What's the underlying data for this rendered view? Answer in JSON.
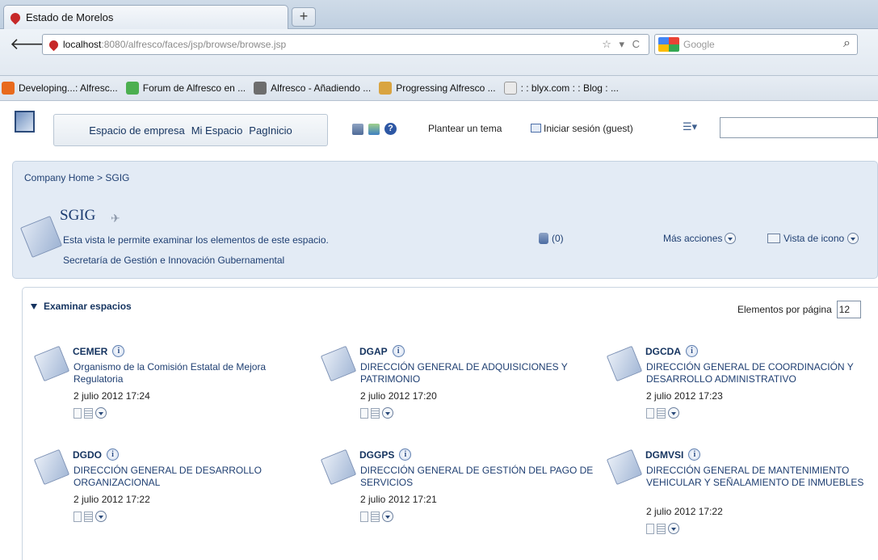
{
  "browser": {
    "tab_title": "Estado de Morelos",
    "new_tab": "+",
    "url_host": "localhost",
    "url_path": ":8080/alfresco/faces/jsp/browse/browse.jsp",
    "search_placeholder": "Google",
    "bookmarks": [
      {
        "label": "Developing...: Alfresc...",
        "color": "#e86a1c"
      },
      {
        "label": "Forum de Alfresco en ...",
        "color": "#4caf50"
      },
      {
        "label": "Alfresco - Añadiendo ...",
        "color": "#6d6d6d"
      },
      {
        "label": "Progressing Alfresco ...",
        "color": "#d9a441"
      },
      {
        "label": ": : blyx.com : : Blog : ...",
        "color": "#eaeaea"
      }
    ]
  },
  "toolbar": {
    "nav_company": "Espacio de empresa",
    "nav_my": "Mi Espacio",
    "nav_home": "PagInicio",
    "ask_topic": "Plantear un tema",
    "login": "Iniciar sesión (guest)"
  },
  "space": {
    "breadcrumb": "Company Home > SGIG",
    "title": "SGIG",
    "description": "Esta vista le permite examinar los elementos de este espacio.",
    "subdescription": "Secretaría de Gestión e Innovación Gubernamental",
    "pending_count": "(0)",
    "more_actions": "Más acciones",
    "icon_view": "Vista de icono"
  },
  "browse": {
    "title": "Examinar espacios",
    "per_page_label": "Elementos por página",
    "per_page_value": "12",
    "spaces": [
      {
        "name": "CEMER",
        "desc": "Organismo de la Comisión Estatal de Mejora Regulatoria",
        "date": "2 julio 2012 17:24"
      },
      {
        "name": "DGAP",
        "desc": "DIRECCIÓN GENERAL DE ADQUISICIONES Y PATRIMONIO",
        "date": "2 julio 2012 17:20"
      },
      {
        "name": "DGCDA",
        "desc": "DIRECCIÓN GENERAL DE COORDINACIÓN Y DESARROLLO ADMINISTRATIVO",
        "date": "2 julio 2012 17:23"
      },
      {
        "name": "DGDO",
        "desc": "DIRECCIÓN GENERAL DE DESARROLLO ORGANIZACIONAL",
        "date": "2 julio 2012 17:22"
      },
      {
        "name": "DGGPS",
        "desc": "DIRECCIÓN GENERAL DE GESTIÓN DEL PAGO DE SERVICIOS",
        "date": "2 julio 2012 17:21"
      },
      {
        "name": "DGMVSI",
        "desc": "DIRECCIÓN GENERAL DE MANTENIMIENTO VEHICULAR Y SEÑALAMIENTO DE INMUEBLES",
        "date": "2 julio 2012 17:22"
      }
    ]
  }
}
